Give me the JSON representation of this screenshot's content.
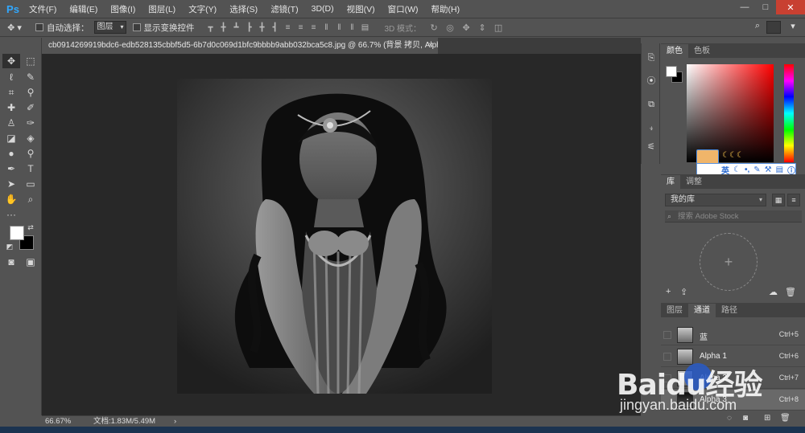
{
  "app": {
    "logo": "Ps",
    "menu": [
      "文件(F)",
      "编辑(E)",
      "图像(I)",
      "图层(L)",
      "文字(Y)",
      "选择(S)",
      "滤镜(T)",
      "3D(D)",
      "视图(V)",
      "窗口(W)",
      "帮助(H)"
    ],
    "window_controls": [
      "—",
      "□",
      "✕"
    ]
  },
  "options": {
    "move_tool_icon": "move-icon",
    "auto_select_label": "自动选择：",
    "auto_select_value": "图层",
    "show_transform_label": "显示变换控件",
    "mode3d_label": "3D 模式："
  },
  "document": {
    "tab_title": "cb0914269919bdc6-edb528135cbbf5d5-6b7d0c069d1bfc9bbbb9abb032bca5c8.jpg @ 66.7% (背景 拷贝, Alpha 3/8) *",
    "close": "×"
  },
  "status": {
    "zoom": "66.67%",
    "doc_info": "文档:1.83M/5.49M",
    "arrow": "›"
  },
  "color_panel": {
    "tabs": [
      "颜色",
      "色板"
    ],
    "foreground": "#ffffff",
    "background": "#000000",
    "ime_label": "英"
  },
  "library_panel": {
    "tabs": [
      "库",
      "调整"
    ],
    "library_select": "我的库",
    "search_placeholder": "搜索 Adobe Stock",
    "add_symbol": "+"
  },
  "channels_panel": {
    "tabs": [
      "图层",
      "通道",
      "路径"
    ],
    "rows": [
      {
        "name": "蓝",
        "shortcut": "Ctrl+5"
      },
      {
        "name": "Alpha 1",
        "shortcut": "Ctrl+6"
      },
      {
        "name": "Alpha 2",
        "shortcut": "Ctrl+7"
      },
      {
        "name": "Alpha 3",
        "shortcut": "Ctrl+8"
      }
    ]
  },
  "watermark": {
    "logo": "Baidu经验",
    "url": "jingyan.baidu.com"
  }
}
